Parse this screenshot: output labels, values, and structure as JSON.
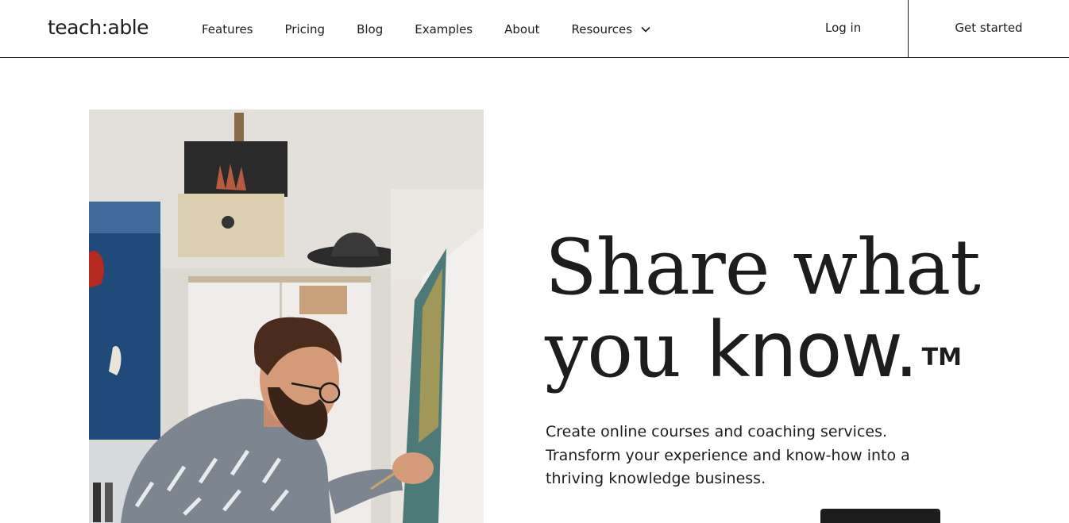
{
  "header": {
    "logo_text": "teach:able",
    "nav": [
      {
        "label": "Features"
      },
      {
        "label": "Pricing"
      },
      {
        "label": "Blog"
      },
      {
        "label": "Examples"
      },
      {
        "label": "About"
      },
      {
        "label": "Resources",
        "icon": "chevron-down-icon"
      }
    ],
    "login_label": "Log in",
    "get_started_label": "Get started"
  },
  "hero": {
    "headline_line1": "Share what",
    "headline_line2_serif": "you",
    "headline_line2_bold": "know.",
    "trademark": "TM",
    "subtext": "Create online courses and coaching services. Transform your experience and know-how into a thriving knowledge business.",
    "image_icon": "hero-photo-artist-painting"
  },
  "colors": {
    "text": "#1d1d1d",
    "background": "#ffffff",
    "button": "#1d1d1d"
  }
}
